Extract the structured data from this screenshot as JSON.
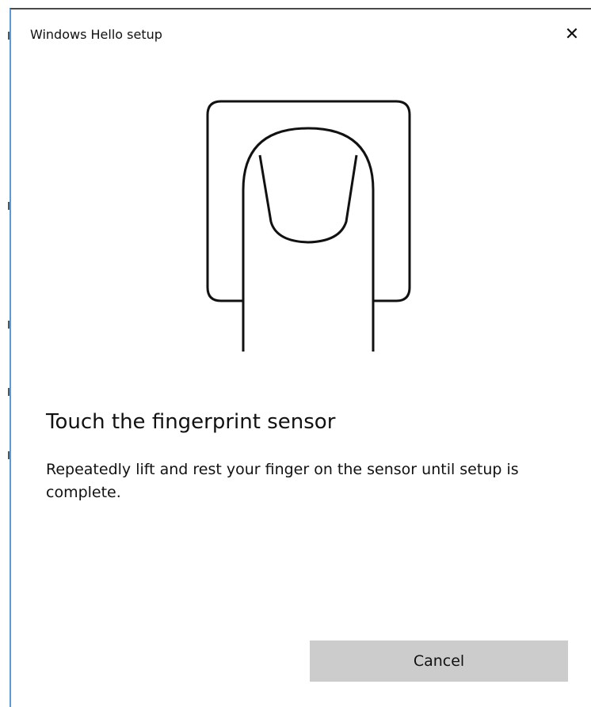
{
  "window": {
    "title": "Windows Hello setup",
    "close_symbol": "✕"
  },
  "illustration": {
    "icon": "fingerprint-sensor-icon"
  },
  "content": {
    "heading": "Touch the fingerprint sensor",
    "description": "Repeatedly lift and rest your finger on the sensor until setup is complete."
  },
  "actions": {
    "cancel_label": "Cancel"
  },
  "colors": {
    "window_border_accent": "#5b9bd5",
    "button_background": "#cccccc",
    "text": "#111111"
  }
}
